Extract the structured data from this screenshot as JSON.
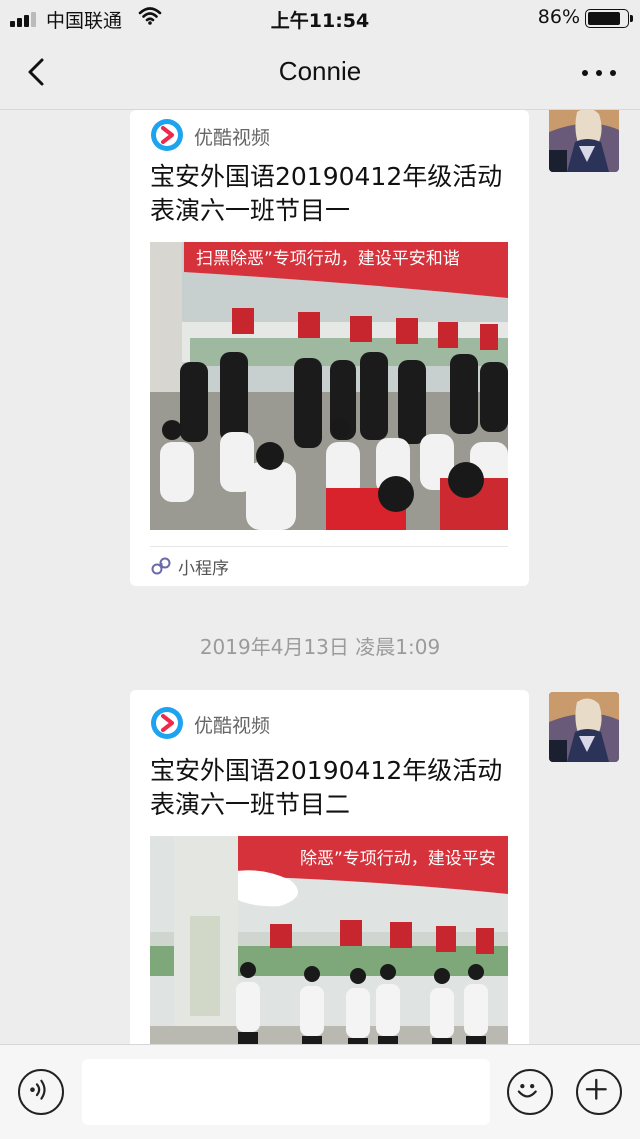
{
  "status_bar": {
    "carrier": "中国联通",
    "time": "上午11:54",
    "battery_percent": "86%",
    "battery_level": 0.86
  },
  "nav": {
    "title": "Connie",
    "back_icon": "chevron-left-icon",
    "more_icon": "more-dots-icon"
  },
  "messages": [
    {
      "type": "video-card",
      "source": "优酷视频",
      "title": "宝安外国语20190412年级活动表演六一班节目一",
      "thumb_banner_text": "扫黑除恶”专项行动，建设平安和谐",
      "footer_label": "小程序"
    },
    {
      "type": "timestamp",
      "text": "2019年4月13日 凌晨1:09"
    },
    {
      "type": "video-card",
      "source": "优酷视频",
      "title": "宝安外国语20190412年级活动表演六一班节目二",
      "thumb_banner_text": "除恶”专项行动，建设平安"
    }
  ],
  "input_bar": {
    "voice_icon": "voice-icon",
    "emoji_icon": "emoji-icon",
    "plus_icon": "plus-icon",
    "text_value": ""
  },
  "colors": {
    "background": "#ededed",
    "card": "#ffffff",
    "youku_blue": "#1ea3f0",
    "youku_red": "#f0284a",
    "banner_red": "#d6323c",
    "timestamp_gray": "#9b9b9b"
  }
}
